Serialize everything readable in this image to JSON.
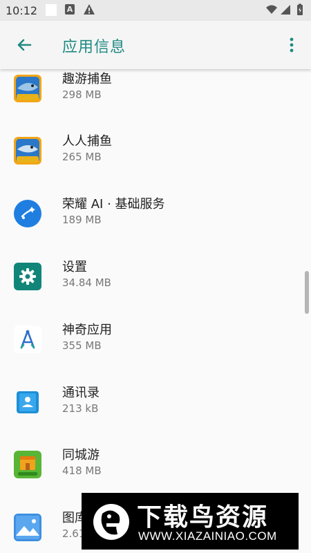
{
  "status_bar": {
    "time": "10:12",
    "a_badge": "A"
  },
  "app_bar": {
    "title": "应用信息"
  },
  "apps": [
    {
      "name": "趣游捕鱼",
      "size": "298 MB",
      "icon": "fish-game-icon"
    },
    {
      "name": "人人捕鱼",
      "size": "265 MB",
      "icon": "fish-game-icon"
    },
    {
      "name": "荣耀 AI · 基础服务",
      "size": "189 MB",
      "icon": "honor-ai-icon"
    },
    {
      "name": "设置",
      "size": "34.84 MB",
      "icon": "settings-gear-icon"
    },
    {
      "name": "神奇应用",
      "size": "355 MB",
      "icon": "compass-app-icon"
    },
    {
      "name": "通讯录",
      "size": "213 kB",
      "icon": "contacts-icon"
    },
    {
      "name": "同城游",
      "size": "418 MB",
      "icon": "tongchengyou-icon"
    },
    {
      "name": "图库",
      "size": "2.61 MB",
      "icon": "gallery-icon"
    }
  ],
  "watermark": {
    "title": "下载鸟资源",
    "url": "WWW.XIAZAINIAO.COM"
  },
  "colors": {
    "accent": "#1e8a82",
    "status_bar_bg": "#e9e9e9",
    "app_bar_bg": "#f5f5f5",
    "list_bg": "#fafafa"
  }
}
